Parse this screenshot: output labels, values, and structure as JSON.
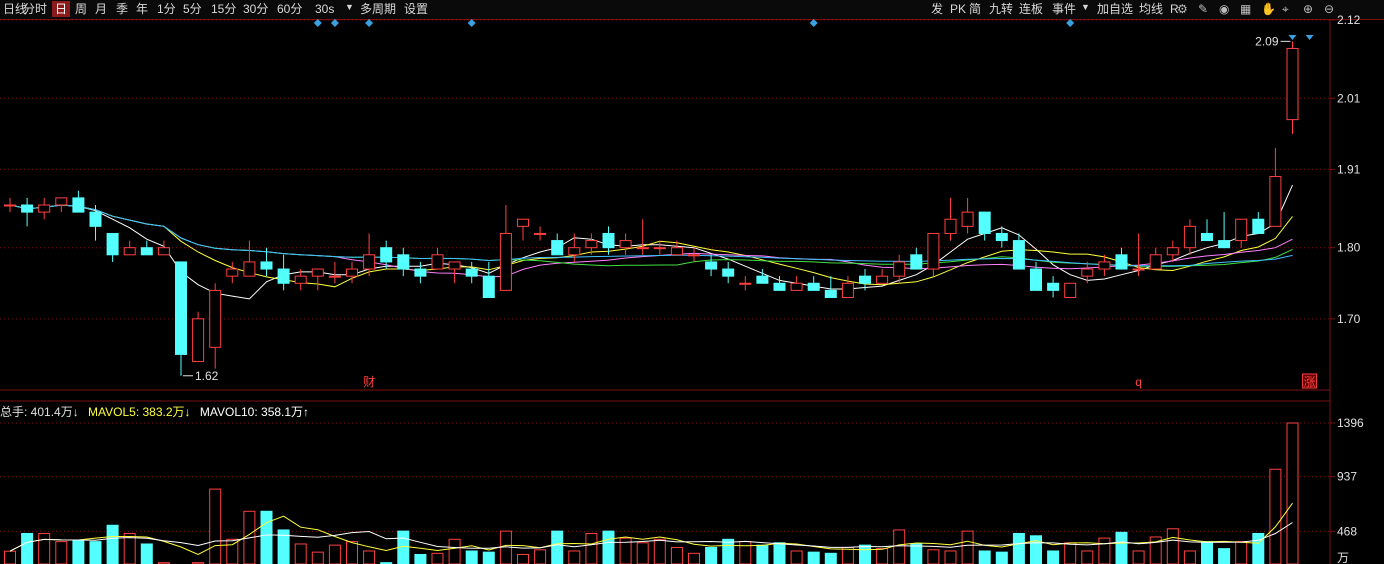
{
  "toolbar": {
    "left_items": [
      "日线",
      "分时",
      "日",
      "周",
      "月",
      "季",
      "年",
      "1分",
      "5分",
      "15分",
      "30分",
      "60分",
      "30s",
      "多周期",
      "设置"
    ],
    "active_item": "日",
    "right_items": [
      "发",
      "PK",
      "简",
      "九转",
      "连板",
      "事件",
      "加自选",
      "均线",
      "R"
    ],
    "icons": [
      "settings-icon",
      "brush-icon",
      "eye-icon",
      "layout-icon",
      "hand-icon",
      "cursor-icon",
      "zoom-in-icon",
      "zoom-out-icon"
    ]
  },
  "colors": {
    "up": "#ff4040",
    "down": "#54ffff",
    "ma_white": "#ffffff",
    "ma_yellow": "#ffff3c",
    "ma_magenta": "#ff80ff",
    "ma_green": "#40e040",
    "ma_blue": "#40c0ff",
    "grid": "#7a1010",
    "event_marker": "#3aa0e0"
  },
  "chart_data": [
    {
      "type": "candlestick",
      "panel": "price",
      "ylim": [
        1.6,
        2.12
      ],
      "y_ticks": [
        "2.12",
        "2.01",
        "1.91",
        "1.80",
        "1.70"
      ],
      "annotations": {
        "high_label": "2.09",
        "low_label": "1.62",
        "markers": [
          "财",
          "q",
          "涨"
        ]
      },
      "candles": [
        {
          "o": 1.86,
          "h": 1.87,
          "l": 1.85,
          "c": 1.86
        },
        {
          "o": 1.86,
          "h": 1.87,
          "l": 1.83,
          "c": 1.85
        },
        {
          "o": 1.85,
          "h": 1.87,
          "l": 1.84,
          "c": 1.86
        },
        {
          "o": 1.86,
          "h": 1.87,
          "l": 1.85,
          "c": 1.87
        },
        {
          "o": 1.87,
          "h": 1.88,
          "l": 1.85,
          "c": 1.85
        },
        {
          "o": 1.85,
          "h": 1.86,
          "l": 1.81,
          "c": 1.83
        },
        {
          "o": 1.82,
          "h": 1.82,
          "l": 1.78,
          "c": 1.79
        },
        {
          "o": 1.79,
          "h": 1.81,
          "l": 1.79,
          "c": 1.8
        },
        {
          "o": 1.8,
          "h": 1.81,
          "l": 1.79,
          "c": 1.79
        },
        {
          "o": 1.79,
          "h": 1.81,
          "l": 1.79,
          "c": 1.8
        },
        {
          "o": 1.78,
          "h": 1.78,
          "l": 1.62,
          "c": 1.65
        },
        {
          "o": 1.64,
          "h": 1.71,
          "l": 1.64,
          "c": 1.7
        },
        {
          "o": 1.66,
          "h": 1.75,
          "l": 1.63,
          "c": 1.74
        },
        {
          "o": 1.76,
          "h": 1.78,
          "l": 1.75,
          "c": 1.77
        },
        {
          "o": 1.76,
          "h": 1.81,
          "l": 1.76,
          "c": 1.78
        },
        {
          "o": 1.78,
          "h": 1.8,
          "l": 1.76,
          "c": 1.77
        },
        {
          "o": 1.77,
          "h": 1.79,
          "l": 1.74,
          "c": 1.75
        },
        {
          "o": 1.75,
          "h": 1.77,
          "l": 1.74,
          "c": 1.76
        },
        {
          "o": 1.76,
          "h": 1.77,
          "l": 1.74,
          "c": 1.77
        },
        {
          "o": 1.76,
          "h": 1.78,
          "l": 1.75,
          "c": 1.76
        },
        {
          "o": 1.76,
          "h": 1.78,
          "l": 1.75,
          "c": 1.77
        },
        {
          "o": 1.77,
          "h": 1.82,
          "l": 1.76,
          "c": 1.79
        },
        {
          "o": 1.8,
          "h": 1.81,
          "l": 1.77,
          "c": 1.78
        },
        {
          "o": 1.79,
          "h": 1.8,
          "l": 1.76,
          "c": 1.77
        },
        {
          "o": 1.77,
          "h": 1.78,
          "l": 1.75,
          "c": 1.76
        },
        {
          "o": 1.77,
          "h": 1.8,
          "l": 1.77,
          "c": 1.79
        },
        {
          "o": 1.77,
          "h": 1.78,
          "l": 1.75,
          "c": 1.78
        },
        {
          "o": 1.77,
          "h": 1.78,
          "l": 1.75,
          "c": 1.76
        },
        {
          "o": 1.76,
          "h": 1.78,
          "l": 1.73,
          "c": 1.73
        },
        {
          "o": 1.74,
          "h": 1.86,
          "l": 1.74,
          "c": 1.82
        },
        {
          "o": 1.83,
          "h": 1.84,
          "l": 1.81,
          "c": 1.84
        },
        {
          "o": 1.82,
          "h": 1.83,
          "l": 1.81,
          "c": 1.82
        },
        {
          "o": 1.81,
          "h": 1.82,
          "l": 1.79,
          "c": 1.79
        },
        {
          "o": 1.79,
          "h": 1.82,
          "l": 1.78,
          "c": 1.8
        },
        {
          "o": 1.8,
          "h": 1.82,
          "l": 1.79,
          "c": 1.81
        },
        {
          "o": 1.82,
          "h": 1.83,
          "l": 1.79,
          "c": 1.8
        },
        {
          "o": 1.8,
          "h": 1.82,
          "l": 1.79,
          "c": 1.81
        },
        {
          "o": 1.8,
          "h": 1.84,
          "l": 1.79,
          "c": 1.8
        },
        {
          "o": 1.8,
          "h": 1.81,
          "l": 1.79,
          "c": 1.8
        },
        {
          "o": 1.79,
          "h": 1.81,
          "l": 1.79,
          "c": 1.8
        },
        {
          "o": 1.79,
          "h": 1.8,
          "l": 1.78,
          "c": 1.79
        },
        {
          "o": 1.78,
          "h": 1.79,
          "l": 1.76,
          "c": 1.77
        },
        {
          "o": 1.77,
          "h": 1.78,
          "l": 1.75,
          "c": 1.76
        },
        {
          "o": 1.75,
          "h": 1.76,
          "l": 1.74,
          "c": 1.75
        },
        {
          "o": 1.76,
          "h": 1.77,
          "l": 1.75,
          "c": 1.75
        },
        {
          "o": 1.75,
          "h": 1.76,
          "l": 1.74,
          "c": 1.74
        },
        {
          "o": 1.74,
          "h": 1.76,
          "l": 1.74,
          "c": 1.75
        },
        {
          "o": 1.75,
          "h": 1.76,
          "l": 1.74,
          "c": 1.74
        },
        {
          "o": 1.74,
          "h": 1.76,
          "l": 1.73,
          "c": 1.73
        },
        {
          "o": 1.73,
          "h": 1.76,
          "l": 1.73,
          "c": 1.75
        },
        {
          "o": 1.76,
          "h": 1.77,
          "l": 1.74,
          "c": 1.75
        },
        {
          "o": 1.75,
          "h": 1.77,
          "l": 1.75,
          "c": 1.76
        },
        {
          "o": 1.76,
          "h": 1.79,
          "l": 1.75,
          "c": 1.78
        },
        {
          "o": 1.79,
          "h": 1.8,
          "l": 1.77,
          "c": 1.77
        },
        {
          "o": 1.77,
          "h": 1.82,
          "l": 1.76,
          "c": 1.82
        },
        {
          "o": 1.82,
          "h": 1.87,
          "l": 1.81,
          "c": 1.84
        },
        {
          "o": 1.83,
          "h": 1.87,
          "l": 1.82,
          "c": 1.85
        },
        {
          "o": 1.85,
          "h": 1.85,
          "l": 1.81,
          "c": 1.82
        },
        {
          "o": 1.82,
          "h": 1.83,
          "l": 1.8,
          "c": 1.81
        },
        {
          "o": 1.81,
          "h": 1.82,
          "l": 1.77,
          "c": 1.77
        },
        {
          "o": 1.77,
          "h": 1.78,
          "l": 1.74,
          "c": 1.74
        },
        {
          "o": 1.75,
          "h": 1.76,
          "l": 1.73,
          "c": 1.74
        },
        {
          "o": 1.73,
          "h": 1.75,
          "l": 1.73,
          "c": 1.75
        },
        {
          "o": 1.76,
          "h": 1.78,
          "l": 1.75,
          "c": 1.77
        },
        {
          "o": 1.77,
          "h": 1.79,
          "l": 1.76,
          "c": 1.78
        },
        {
          "o": 1.79,
          "h": 1.8,
          "l": 1.77,
          "c": 1.77
        },
        {
          "o": 1.77,
          "h": 1.82,
          "l": 1.76,
          "c": 1.77
        },
        {
          "o": 1.77,
          "h": 1.8,
          "l": 1.77,
          "c": 1.79
        },
        {
          "o": 1.79,
          "h": 1.81,
          "l": 1.78,
          "c": 1.8
        },
        {
          "o": 1.8,
          "h": 1.84,
          "l": 1.79,
          "c": 1.83
        },
        {
          "o": 1.82,
          "h": 1.84,
          "l": 1.81,
          "c": 1.81
        },
        {
          "o": 1.81,
          "h": 1.85,
          "l": 1.8,
          "c": 1.8
        },
        {
          "o": 1.81,
          "h": 1.84,
          "l": 1.8,
          "c": 1.84
        },
        {
          "o": 1.84,
          "h": 1.85,
          "l": 1.82,
          "c": 1.82
        },
        {
          "o": 1.83,
          "h": 1.94,
          "l": 1.83,
          "c": 1.9
        },
        {
          "o": 1.98,
          "h": 2.09,
          "l": 1.96,
          "c": 2.08
        }
      ]
    },
    {
      "type": "bar",
      "panel": "volume",
      "unit": "万",
      "ylim": [
        0,
        1396
      ],
      "y_ticks": [
        "1396",
        "937",
        "468"
      ],
      "legend": {
        "total": "总手: 401.4万↓",
        "mavol5": "MAVOL5: 383.2万↓",
        "mavol10": "MAVOL10: 358.1万↑"
      },
      "values": [
        298,
        450,
        450,
        380,
        390,
        380,
        520,
        450,
        360,
        200,
        140,
        200,
        830,
        400,
        640,
        640,
        480,
        360,
        290,
        350,
        380,
        300,
        200,
        470,
        270,
        280,
        400,
        300,
        290,
        470,
        270,
        310,
        470,
        300,
        450,
        470,
        410,
        370,
        400,
        330,
        280,
        330,
        400,
        380,
        350,
        370,
        300,
        290,
        280,
        330,
        350,
        320,
        480,
        360,
        310,
        300,
        470,
        300,
        290,
        450,
        430,
        300,
        370,
        300,
        410,
        460,
        300,
        420,
        490,
        300,
        380,
        320,
        380,
        450,
        1000,
        1396
      ]
    }
  ]
}
